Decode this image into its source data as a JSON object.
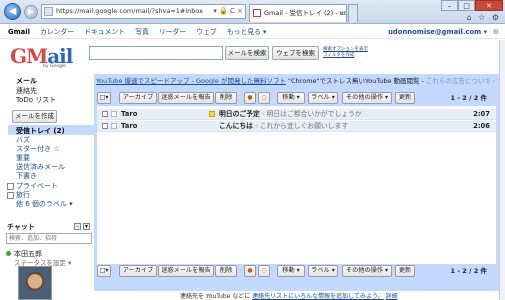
{
  "browser": {
    "url": "https://mail.google.com/mail/?shva=1#inbox",
    "tab_title": "Gmail - 受信トレイ (2) - udon...",
    "close_label": "×",
    "addr_buttons": "▾ 🔒 C ×",
    "tools_icons": "⌂ ☆ ⚙"
  },
  "gbar": {
    "links": [
      "Gmail",
      "カレンダー",
      "ドキュメント",
      "写真",
      "リーダー",
      "ウェブ",
      "もっと見る ▾"
    ],
    "user": "udonnomise@gmail.com ▾"
  },
  "logo": {
    "text_main": "GM",
    "text_tail": "ail",
    "by": "by Google"
  },
  "search": {
    "mail_button": "メールを検索",
    "web_button": "ウェブを検索",
    "options": "検索オプションを表示",
    "filter": "フィルタを作成"
  },
  "sidebar": {
    "top_items": [
      "メール",
      "連絡先",
      "ToDo リスト"
    ],
    "compose": "メールを作成",
    "folders": [
      "受信トレイ (2)",
      "バズ",
      "スター付き ☆",
      "重要",
      "送信済みメール",
      "下書き"
    ],
    "labels": [
      "プライベート",
      "旅行",
      "他 6 個のラベル ▾"
    ],
    "chat_title": "チャット",
    "chat_search": "検索、追加、招待",
    "chat_user": "本田五郎",
    "chat_status": "ステータスを設定 ▾"
  },
  "ad": {
    "link": "YouTube 爆速でスピードアップ - Google が開発した無料ソフト",
    "text": " \"Chrome\"でストレス無いYouTube 動画閲覧 - ",
    "faint": "これらの広告について",
    "arrows": "‹ ›"
  },
  "toolbar": {
    "archive": "アーカイブ",
    "spam": "迷惑メールを報告",
    "delete": "削除",
    "move": "移動 ▾",
    "labels": "ラベル ▾",
    "more": "その他の操作 ▾",
    "refresh": "更新",
    "count": "1 - 2 / 2 件"
  },
  "emails": [
    {
      "from": "Taro",
      "subject": "明日のご予定",
      "snippet": " - 明日はご都合いかがでしょうか",
      "time": "2:07",
      "important": true
    },
    {
      "from": "Taro",
      "subject": "こんにちは",
      "snippet": " - これから宜しくお願いします",
      "time": "2:06",
      "important": false
    }
  ],
  "footer": {
    "text": "連絡先を YouTube などに",
    "link": "連絡先リストにいろんな情報を追加してみよう。",
    "link2": "詳細"
  }
}
